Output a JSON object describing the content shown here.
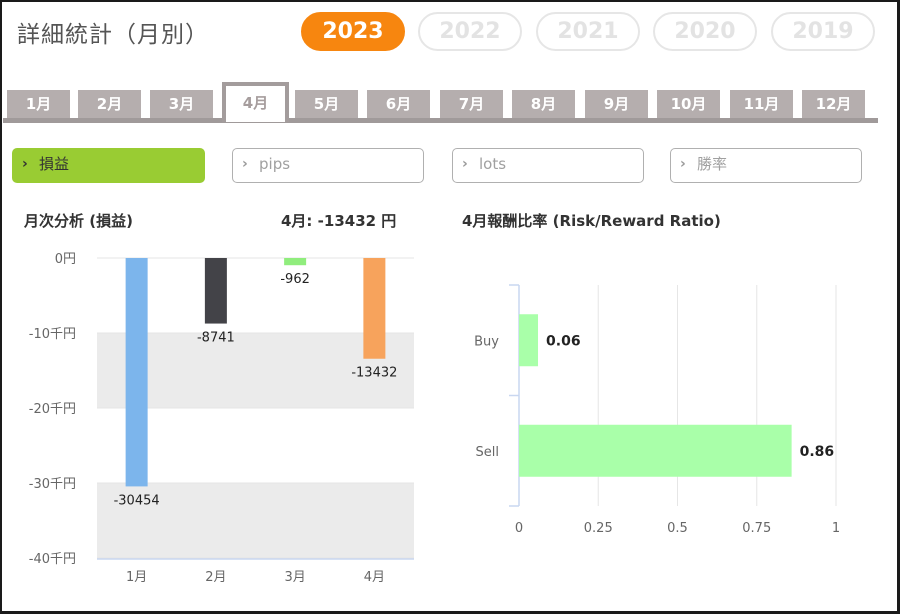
{
  "page": {
    "title": "詳細統計（月別）"
  },
  "years": [
    {
      "label": "2023",
      "active": true
    },
    {
      "label": "2022",
      "active": false
    },
    {
      "label": "2021",
      "active": false
    },
    {
      "label": "2020",
      "active": false
    },
    {
      "label": "2019",
      "active": false
    }
  ],
  "months": [
    {
      "label": "1月"
    },
    {
      "label": "2月"
    },
    {
      "label": "3月"
    },
    {
      "label": "4月",
      "active": true
    },
    {
      "label": "5月"
    },
    {
      "label": "6月"
    },
    {
      "label": "7月"
    },
    {
      "label": "8月"
    },
    {
      "label": "9月"
    },
    {
      "label": "10月"
    },
    {
      "label": "11月"
    },
    {
      "label": "12月"
    }
  ],
  "metrics": [
    {
      "label": "損益",
      "active": true
    },
    {
      "label": "pips"
    },
    {
      "label": "lots"
    },
    {
      "label": "勝率"
    }
  ],
  "monthly": {
    "heading": "月次分析 (損益)",
    "summary": "4月:  -13432 円"
  },
  "rr": {
    "heading": "4月報酬比率 (Risk/Reward Ratio)"
  },
  "chart_data": [
    {
      "type": "bar",
      "title": "月次分析 (損益)",
      "categories": [
        "1月",
        "2月",
        "3月",
        "4月"
      ],
      "values": [
        -30454,
        -8741,
        -962,
        -13432
      ],
      "data_labels": [
        "-30454",
        "-8741",
        "-962",
        "-13432"
      ],
      "colors": [
        "#7cb5ec",
        "#434348",
        "#90ed7d",
        "#f7a35c"
      ],
      "yticks": [
        "0円",
        "-10千円",
        "-20千円",
        "-30千円",
        "-40千円"
      ],
      "ylim": [
        -40000,
        0
      ],
      "grid": "alternating bands"
    },
    {
      "type": "bar",
      "orientation": "horizontal",
      "title": "4月報酬比率 (Risk/Reward Ratio)",
      "categories": [
        "Buy",
        "Sell"
      ],
      "values": [
        0.06,
        0.86
      ],
      "data_labels": [
        "0.06",
        "0.86"
      ],
      "color": "#a9ffa9",
      "xticks": [
        "0",
        "0.25",
        "0.5",
        "0.75",
        "1"
      ],
      "xlim": [
        0,
        1
      ],
      "grid": true
    }
  ]
}
